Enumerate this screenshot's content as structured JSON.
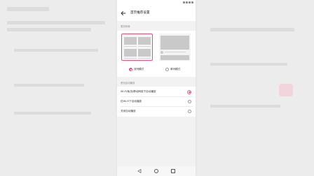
{
  "header": {
    "title": "首页推荐设置"
  },
  "sections": {
    "mode_label": "首页布局",
    "autoplay_label": "首页自动播放"
  },
  "layout_modes": [
    {
      "label": "双列模式",
      "selected": true
    },
    {
      "label": "单列模式",
      "selected": false
    }
  ],
  "autoplay_options": [
    {
      "label": "Wi-Fi/免流/移动网络下自动播放",
      "selected": true
    },
    {
      "label": "仅Wi-Fi下自动播放",
      "selected": false
    },
    {
      "label": "关闭自动播放",
      "selected": false
    }
  ],
  "colors": {
    "accent": "#e8507a"
  }
}
